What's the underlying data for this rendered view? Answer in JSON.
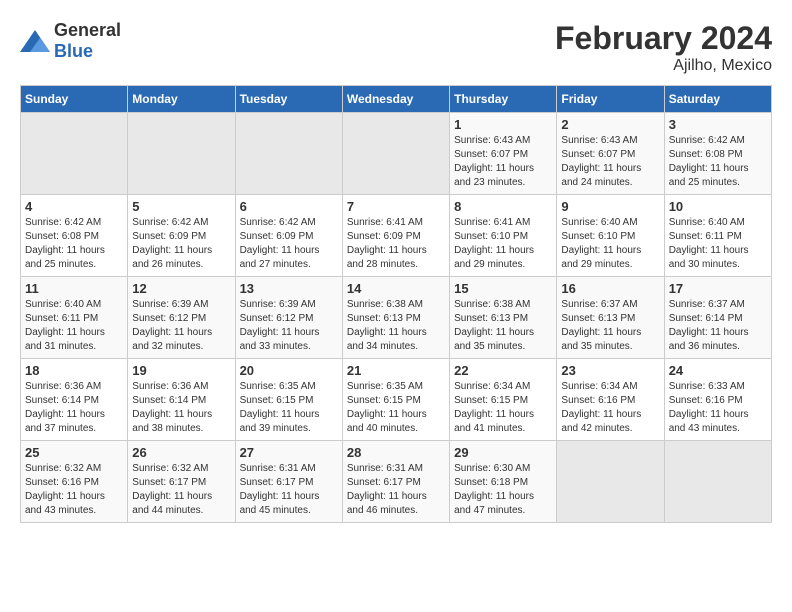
{
  "header": {
    "logo_general": "General",
    "logo_blue": "Blue",
    "main_title": "February 2024",
    "subtitle": "Ajilho, Mexico"
  },
  "weekdays": [
    "Sunday",
    "Monday",
    "Tuesday",
    "Wednesday",
    "Thursday",
    "Friday",
    "Saturday"
  ],
  "weeks": [
    [
      {
        "day": "",
        "info": "",
        "empty": true
      },
      {
        "day": "",
        "info": "",
        "empty": true
      },
      {
        "day": "",
        "info": "",
        "empty": true
      },
      {
        "day": "",
        "info": "",
        "empty": true
      },
      {
        "day": "1",
        "info": "Sunrise: 6:43 AM\nSunset: 6:07 PM\nDaylight: 11 hours and 23 minutes."
      },
      {
        "day": "2",
        "info": "Sunrise: 6:43 AM\nSunset: 6:07 PM\nDaylight: 11 hours and 24 minutes."
      },
      {
        "day": "3",
        "info": "Sunrise: 6:42 AM\nSunset: 6:08 PM\nDaylight: 11 hours and 25 minutes."
      }
    ],
    [
      {
        "day": "4",
        "info": "Sunrise: 6:42 AM\nSunset: 6:08 PM\nDaylight: 11 hours and 25 minutes."
      },
      {
        "day": "5",
        "info": "Sunrise: 6:42 AM\nSunset: 6:09 PM\nDaylight: 11 hours and 26 minutes."
      },
      {
        "day": "6",
        "info": "Sunrise: 6:42 AM\nSunset: 6:09 PM\nDaylight: 11 hours and 27 minutes."
      },
      {
        "day": "7",
        "info": "Sunrise: 6:41 AM\nSunset: 6:09 PM\nDaylight: 11 hours and 28 minutes."
      },
      {
        "day": "8",
        "info": "Sunrise: 6:41 AM\nSunset: 6:10 PM\nDaylight: 11 hours and 29 minutes."
      },
      {
        "day": "9",
        "info": "Sunrise: 6:40 AM\nSunset: 6:10 PM\nDaylight: 11 hours and 29 minutes."
      },
      {
        "day": "10",
        "info": "Sunrise: 6:40 AM\nSunset: 6:11 PM\nDaylight: 11 hours and 30 minutes."
      }
    ],
    [
      {
        "day": "11",
        "info": "Sunrise: 6:40 AM\nSunset: 6:11 PM\nDaylight: 11 hours and 31 minutes."
      },
      {
        "day": "12",
        "info": "Sunrise: 6:39 AM\nSunset: 6:12 PM\nDaylight: 11 hours and 32 minutes."
      },
      {
        "day": "13",
        "info": "Sunrise: 6:39 AM\nSunset: 6:12 PM\nDaylight: 11 hours and 33 minutes."
      },
      {
        "day": "14",
        "info": "Sunrise: 6:38 AM\nSunset: 6:13 PM\nDaylight: 11 hours and 34 minutes."
      },
      {
        "day": "15",
        "info": "Sunrise: 6:38 AM\nSunset: 6:13 PM\nDaylight: 11 hours and 35 minutes."
      },
      {
        "day": "16",
        "info": "Sunrise: 6:37 AM\nSunset: 6:13 PM\nDaylight: 11 hours and 35 minutes."
      },
      {
        "day": "17",
        "info": "Sunrise: 6:37 AM\nSunset: 6:14 PM\nDaylight: 11 hours and 36 minutes."
      }
    ],
    [
      {
        "day": "18",
        "info": "Sunrise: 6:36 AM\nSunset: 6:14 PM\nDaylight: 11 hours and 37 minutes."
      },
      {
        "day": "19",
        "info": "Sunrise: 6:36 AM\nSunset: 6:14 PM\nDaylight: 11 hours and 38 minutes."
      },
      {
        "day": "20",
        "info": "Sunrise: 6:35 AM\nSunset: 6:15 PM\nDaylight: 11 hours and 39 minutes."
      },
      {
        "day": "21",
        "info": "Sunrise: 6:35 AM\nSunset: 6:15 PM\nDaylight: 11 hours and 40 minutes."
      },
      {
        "day": "22",
        "info": "Sunrise: 6:34 AM\nSunset: 6:15 PM\nDaylight: 11 hours and 41 minutes."
      },
      {
        "day": "23",
        "info": "Sunrise: 6:34 AM\nSunset: 6:16 PM\nDaylight: 11 hours and 42 minutes."
      },
      {
        "day": "24",
        "info": "Sunrise: 6:33 AM\nSunset: 6:16 PM\nDaylight: 11 hours and 43 minutes."
      }
    ],
    [
      {
        "day": "25",
        "info": "Sunrise: 6:32 AM\nSunset: 6:16 PM\nDaylight: 11 hours and 43 minutes."
      },
      {
        "day": "26",
        "info": "Sunrise: 6:32 AM\nSunset: 6:17 PM\nDaylight: 11 hours and 44 minutes."
      },
      {
        "day": "27",
        "info": "Sunrise: 6:31 AM\nSunset: 6:17 PM\nDaylight: 11 hours and 45 minutes."
      },
      {
        "day": "28",
        "info": "Sunrise: 6:31 AM\nSunset: 6:17 PM\nDaylight: 11 hours and 46 minutes."
      },
      {
        "day": "29",
        "info": "Sunrise: 6:30 AM\nSunset: 6:18 PM\nDaylight: 11 hours and 47 minutes."
      },
      {
        "day": "",
        "info": "",
        "empty": true
      },
      {
        "day": "",
        "info": "",
        "empty": true
      }
    ]
  ]
}
